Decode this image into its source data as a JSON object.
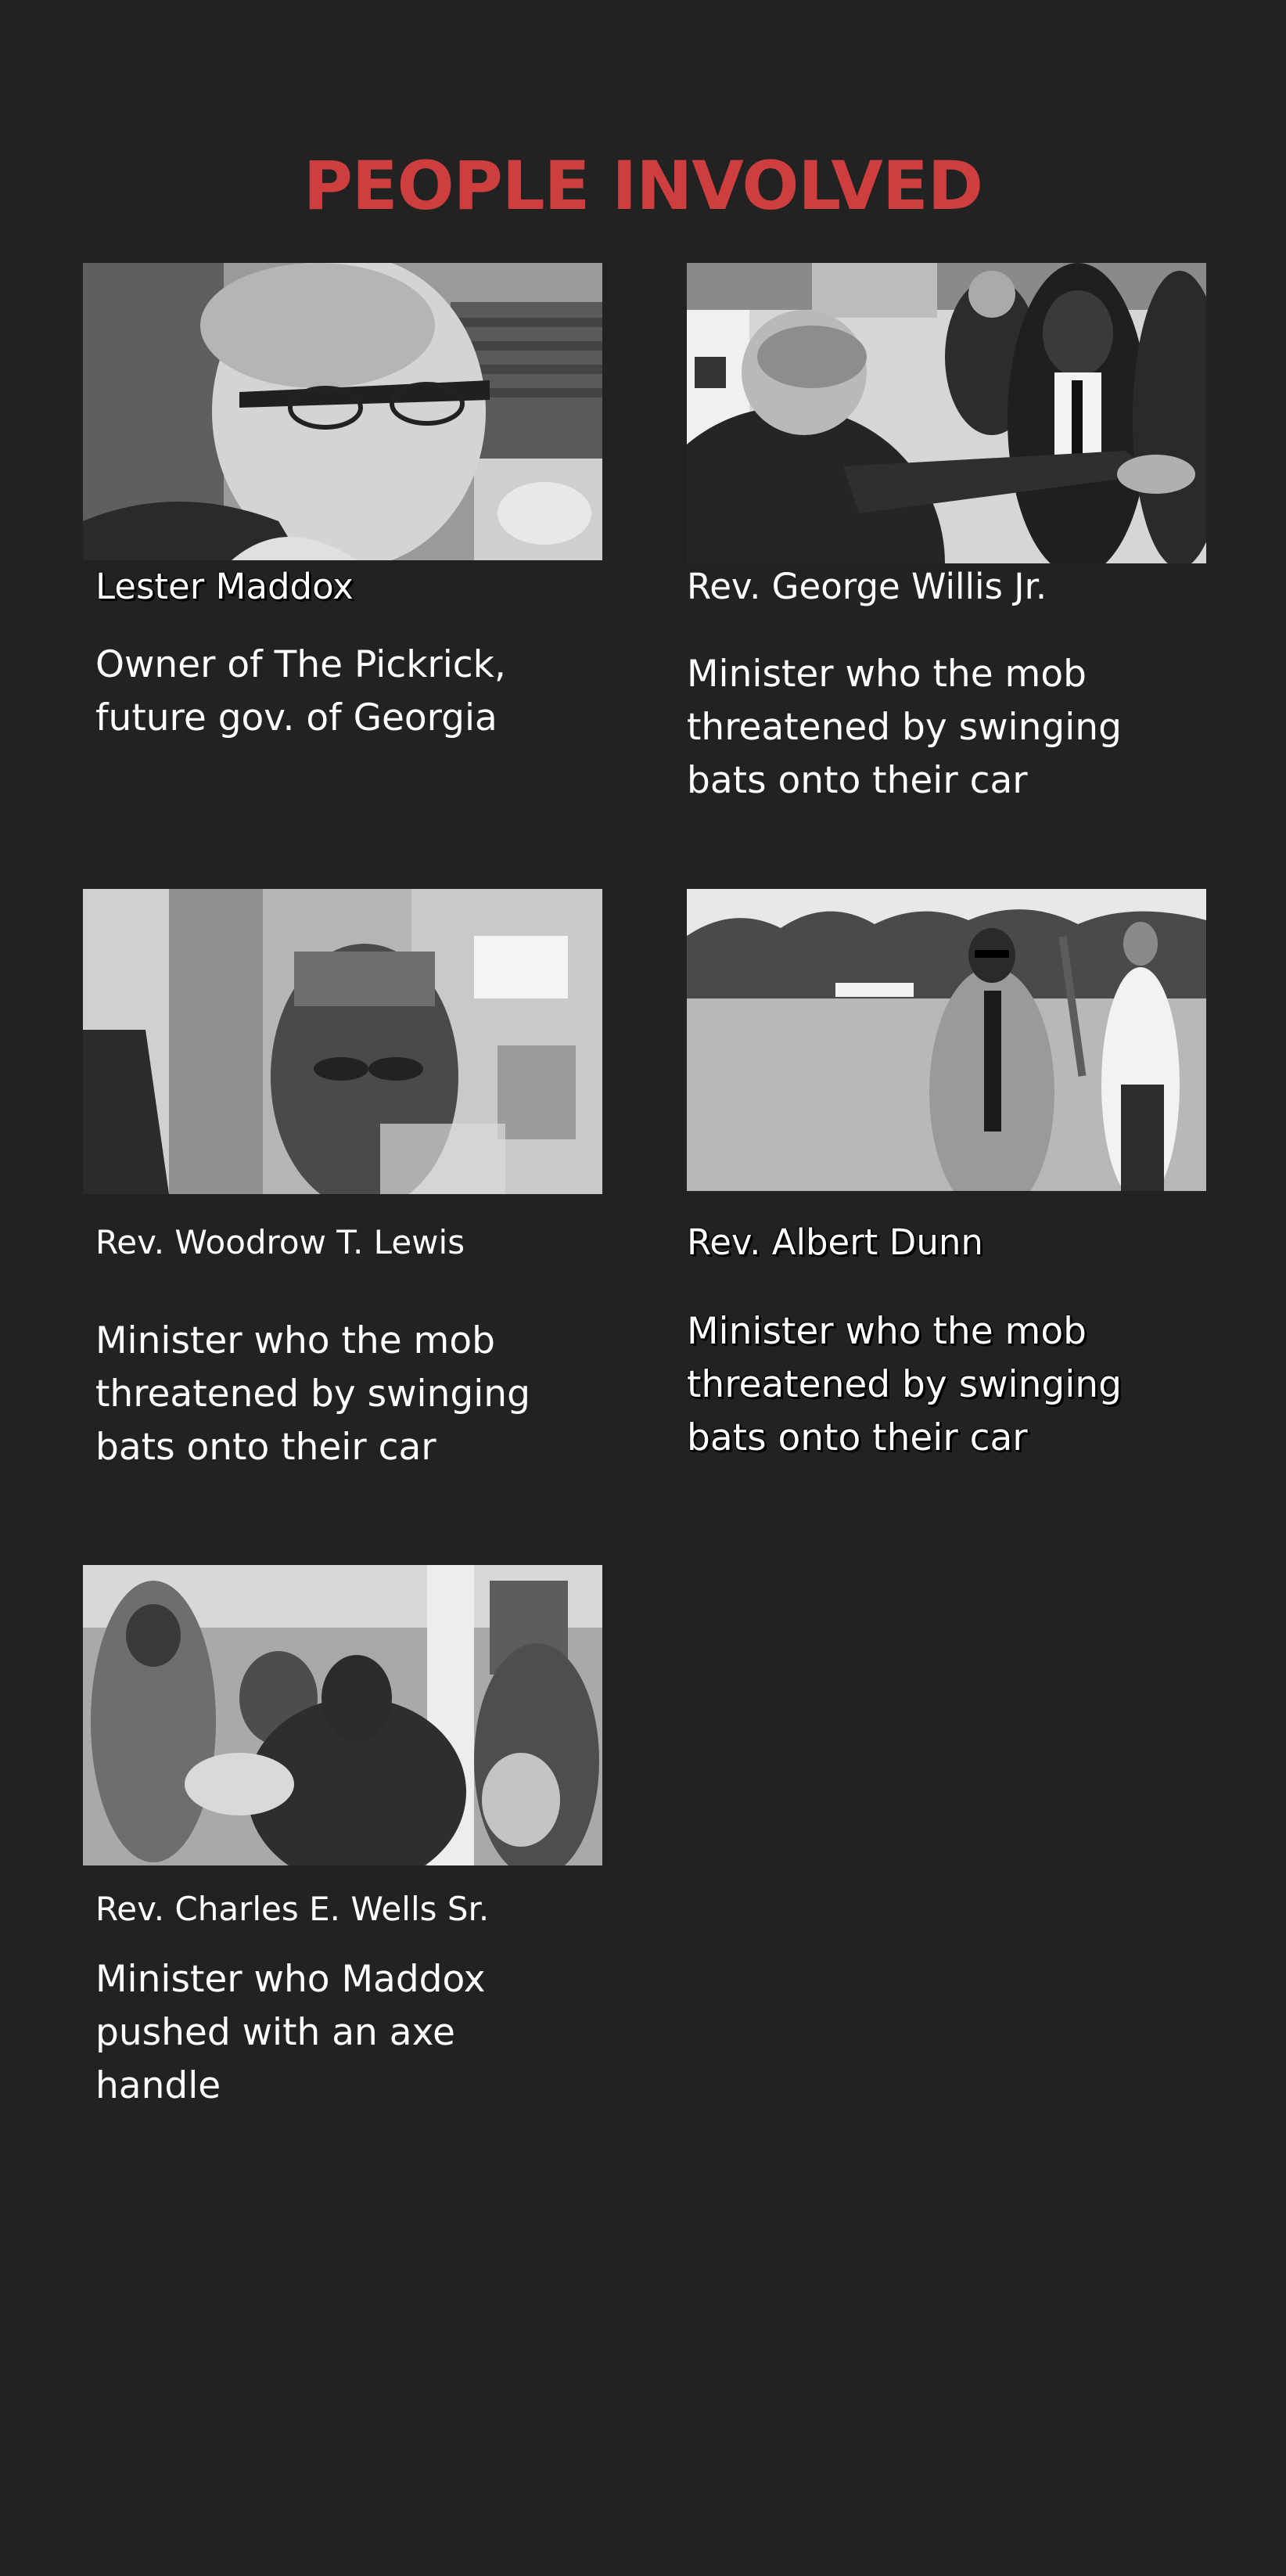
{
  "page": {
    "title": "PEOPLE INVOLVED"
  },
  "colors": {
    "background": "#222222",
    "title": "#cf3e3e",
    "text": "#ffffff"
  },
  "people": [
    {
      "name": "Lester Maddox",
      "description": "Owner of The Pickrick, future gov. of Georgia"
    },
    {
      "name": "Rev. George Willis Jr.",
      "description": "Minister who the mob threatened by swinging bats onto their car"
    },
    {
      "name": "Rev. Woodrow T. Lewis",
      "description": "Minister who the mob threatened by swinging bats onto their car"
    },
    {
      "name": "Rev. Albert Dunn",
      "description": "Minister who the mob threatened by swinging bats onto their car"
    },
    {
      "name": "Rev. Charles E. Wells Sr.",
      "description": "Minister who Maddox pushed with an axe handle"
    }
  ]
}
